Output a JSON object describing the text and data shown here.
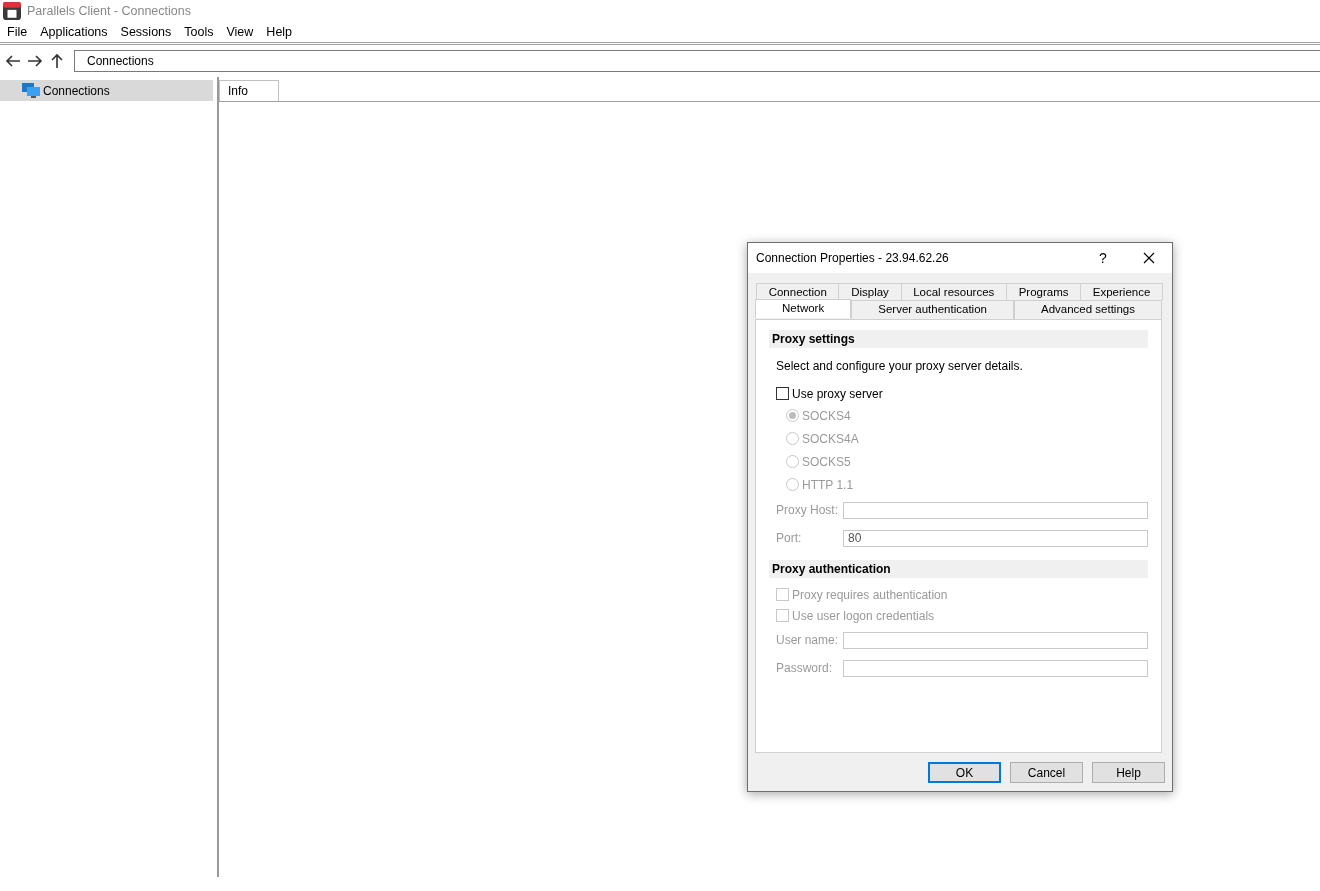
{
  "window": {
    "title": "Parallels Client - Connections"
  },
  "menu": [
    "File",
    "Applications",
    "Sessions",
    "Tools",
    "View",
    "Help"
  ],
  "address_bar": {
    "value": "Connections"
  },
  "sidebar": {
    "items": [
      {
        "label": "Connections",
        "selected": true
      }
    ]
  },
  "content": {
    "tabs": [
      {
        "label": "Info",
        "selected": true
      }
    ]
  },
  "dialog": {
    "title": "Connection Properties - 23.94.62.26",
    "help_button": "?",
    "tab_rows": [
      [
        {
          "label": "Connection",
          "selected": false
        },
        {
          "label": "Display",
          "selected": false
        },
        {
          "label": "Local resources",
          "selected": false
        },
        {
          "label": "Programs",
          "selected": false
        },
        {
          "label": "Experience",
          "selected": false
        }
      ],
      [
        {
          "label": "Network",
          "selected": true
        },
        {
          "label": "Server authentication",
          "selected": false
        },
        {
          "label": "Advanced settings",
          "selected": false
        }
      ]
    ],
    "sections": [
      {
        "heading": "Proxy settings",
        "items": [
          {
            "kind": "text",
            "label": "Select and configure your proxy server details."
          },
          {
            "kind": "checkbox",
            "label": "Use proxy server",
            "checked": false,
            "disabled": false
          },
          {
            "kind": "radio",
            "label": "SOCKS4",
            "selected": true,
            "disabled": true
          },
          {
            "kind": "radio",
            "label": "SOCKS4A",
            "selected": false,
            "disabled": true
          },
          {
            "kind": "radio",
            "label": "SOCKS5",
            "selected": false,
            "disabled": true
          },
          {
            "kind": "radio",
            "label": "HTTP 1.1",
            "selected": false,
            "disabled": true
          },
          {
            "kind": "field",
            "label": "Proxy Host:",
            "value": "",
            "disabled": true
          },
          {
            "kind": "field",
            "label": "Port:",
            "value": "80",
            "disabled": true
          }
        ]
      },
      {
        "heading": "Proxy authentication",
        "items": [
          {
            "kind": "checkbox",
            "label": "Proxy requires authentication",
            "checked": false,
            "disabled": true
          },
          {
            "kind": "checkbox",
            "label": "Use user logon credentials",
            "checked": false,
            "disabled": true
          },
          {
            "kind": "field",
            "label": "User name:",
            "value": "",
            "disabled": true
          },
          {
            "kind": "field",
            "label": "Password:",
            "value": "",
            "disabled": true
          }
        ]
      }
    ],
    "buttons": [
      {
        "label": "OK",
        "default": true
      },
      {
        "label": "Cancel",
        "default": false
      },
      {
        "label": "Help",
        "default": false
      }
    ]
  }
}
